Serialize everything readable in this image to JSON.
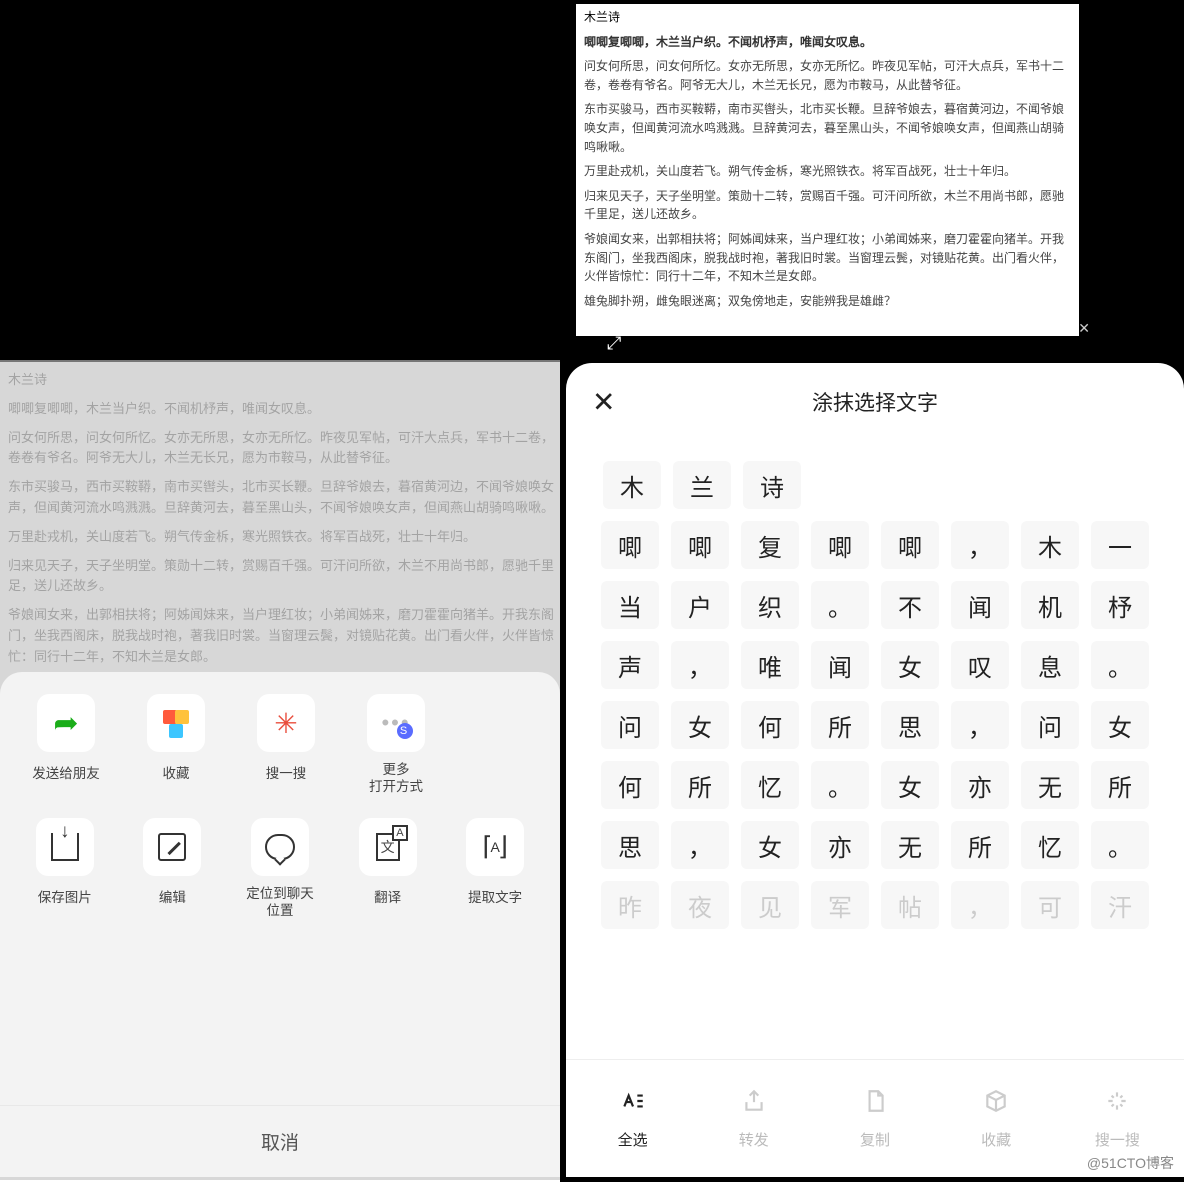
{
  "poem": {
    "title": "木兰诗",
    "paragraphs": [
      "唧唧复唧唧，木兰当户织。不闻机杼声，唯闻女叹息。",
      "问女何所思，问女何所忆。女亦无所思，女亦无所忆。昨夜见军帖，可汗大点兵，军书十二卷，卷卷有爷名。阿爷无大儿，木兰无长兄，愿为市鞍马，从此替爷征。",
      "东市买骏马，西市买鞍鞯，南市买辔头，北市买长鞭。旦辞爷娘去，暮宿黄河边，不闻爷娘唤女声，但闻黄河流水鸣溅溅。旦辞黄河去，暮至黑山头，不闻爷娘唤女声，但闻燕山胡骑鸣啾啾。",
      "万里赴戎机，关山度若飞。朔气传金柝，寒光照铁衣。将军百战死，壮士十年归。",
      "归来见天子，天子坐明堂。策勋十二转，赏赐百千强。可汗问所欲，木兰不用尚书郎，愿驰千里足，送儿还故乡。",
      "爷娘闻女来，出郭相扶将；阿姊闻妹来，当户理红妆；小弟闻姊来，磨刀霍霍向猪羊。开我东阁门，坐我西阁床，脱我战时袍，著我旧时裳。当窗理云鬓，对镜贴花黄。出门看火伴，火伴皆惊忙：同行十二年，不知木兰是女郎。",
      "雄兔脚扑朔，雌兔眼迷离；双兔傍地走，安能辨我是雄雌？"
    ]
  },
  "shareSheet": {
    "row1": [
      {
        "label": "发送给朋友"
      },
      {
        "label": "收藏"
      },
      {
        "label": "搜一搜"
      },
      {
        "label": "更多\n打开方式"
      }
    ],
    "row2": [
      {
        "label": "保存图片"
      },
      {
        "label": "编辑"
      },
      {
        "label": "定位到聊天\n位置"
      },
      {
        "label": "翻译"
      },
      {
        "label": "提取文字"
      }
    ],
    "cancel": "取消"
  },
  "extract": {
    "title": "涂抹选择文字",
    "chars": [
      [
        "木",
        "兰",
        "诗"
      ],
      [
        "唧",
        "唧",
        "复",
        "唧",
        "唧",
        "，",
        "木",
        "一"
      ],
      [
        "当",
        "户",
        "织",
        "。",
        "不",
        "闻",
        "机",
        "杼"
      ],
      [
        "声",
        "，",
        "唯",
        "闻",
        "女",
        "叹",
        "息",
        "。"
      ],
      [
        "问",
        "女",
        "何",
        "所",
        "思",
        "，",
        "问",
        "女"
      ],
      [
        "何",
        "所",
        "忆",
        "。",
        "女",
        "亦",
        "无",
        "所"
      ],
      [
        "思",
        "，",
        "女",
        "亦",
        "无",
        "所",
        "忆",
        "。"
      ],
      [
        "昨",
        "夜",
        "见",
        "军",
        "帖",
        "，",
        "可",
        "汗"
      ]
    ],
    "bottomBar": [
      {
        "label": "全选",
        "active": true
      },
      {
        "label": "转发",
        "active": false
      },
      {
        "label": "复制",
        "active": false
      },
      {
        "label": "收藏",
        "active": false
      },
      {
        "label": "搜一搜",
        "active": false
      }
    ]
  },
  "watermark": "@51CTO博客"
}
